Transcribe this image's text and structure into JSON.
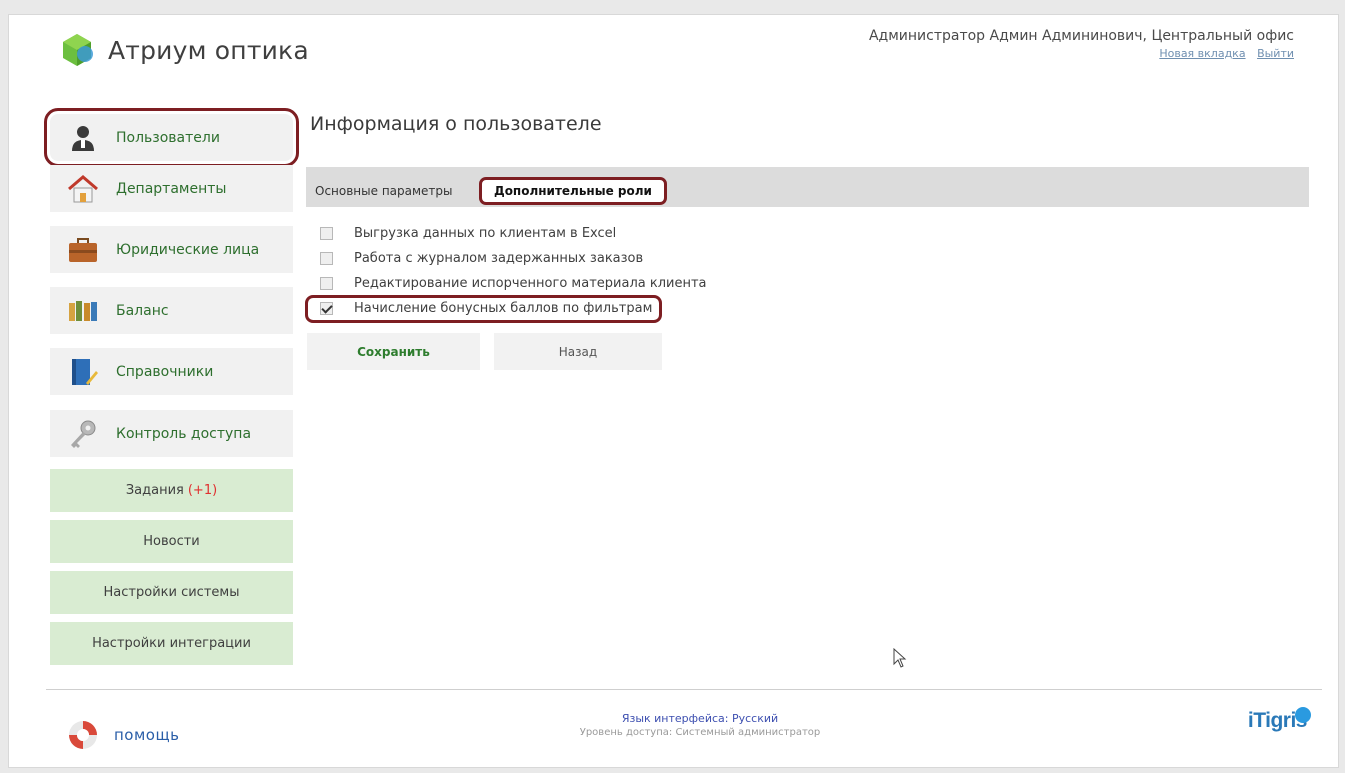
{
  "app": {
    "title": "Атриум оптика"
  },
  "header": {
    "user": "Администратор Админ Админинович, Центральный офис",
    "new_tab": "Новая вкладка",
    "logout": "Выйти"
  },
  "sidebar": {
    "items": [
      {
        "label": "Пользователи",
        "icon": "user-icon",
        "active": true
      },
      {
        "label": "Департаменты",
        "icon": "house-icon"
      },
      {
        "label": "Юридические лица",
        "icon": "briefcase-icon"
      },
      {
        "label": "Баланс",
        "icon": "books-icon"
      },
      {
        "label": "Справочники",
        "icon": "notebook-icon"
      },
      {
        "label": "Контроль доступа",
        "icon": "key-icon"
      }
    ],
    "sub_items": [
      {
        "label": "Задания",
        "badge": "(+1)"
      },
      {
        "label": "Новости"
      },
      {
        "label": "Настройки системы"
      },
      {
        "label": "Настройки интеграции"
      }
    ]
  },
  "main": {
    "title": "Информация о пользователе",
    "tabs": [
      {
        "label": "Основные параметры"
      },
      {
        "label": "Дополнительные роли",
        "active": true
      }
    ],
    "options": [
      {
        "label": "Выгрузка данных по клиентам в Excel",
        "checked": false
      },
      {
        "label": "Работа с журналом задержанных заказов",
        "checked": false
      },
      {
        "label": "Редактирование испорченного материала клиента",
        "checked": false
      },
      {
        "label": "Начисление бонусных баллов по фильтрам",
        "checked": true
      }
    ],
    "save_label": "Сохранить",
    "back_label": "Назад"
  },
  "footer": {
    "help": "помощь",
    "lang_label": "Язык интерфейса:",
    "lang_value": "Русский",
    "access": "Уровень доступа: Системный администратор",
    "brand": "iTigris"
  },
  "colors": {
    "accent_green": "#2e6f2e",
    "highlight": "#7d1e22",
    "sub_nav_bg": "#d9ecd2",
    "badge": "#e03030",
    "brand": "#2a79b8"
  }
}
